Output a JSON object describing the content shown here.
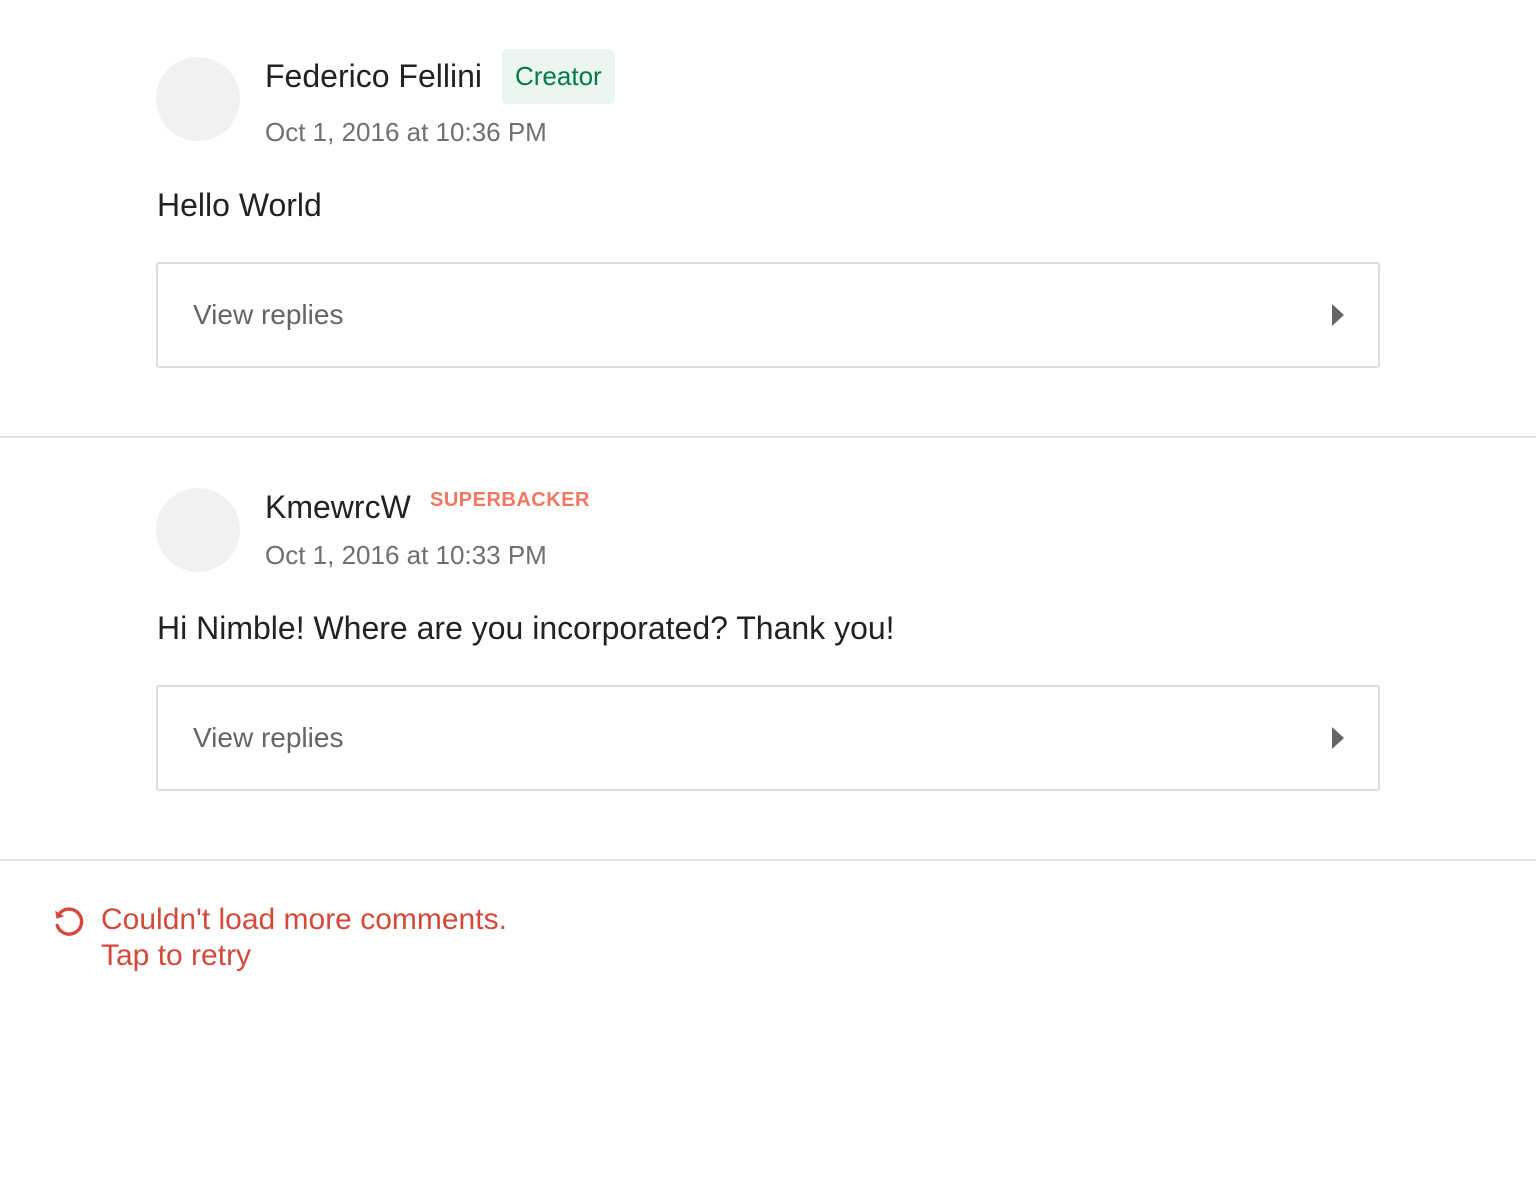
{
  "comments": [
    {
      "author": "Federico Fellini",
      "badge": "Creator",
      "timestamp": "Oct 1, 2016 at 10:36 PM",
      "body": "Hello World",
      "replies_label": "View replies"
    },
    {
      "author": "KmewrcW",
      "badge": "SUPERBACKER",
      "timestamp": "Oct 1, 2016 at 10:33 PM",
      "body": "Hi Nimble! Where are you incorporated? Thank you!",
      "replies_label": "View replies"
    }
  ],
  "error": {
    "line1": "Couldn't load more comments.",
    "line2": "Tap to retry",
    "icon": "retry-icon"
  },
  "colors": {
    "creator_badge_text": "#037a4b",
    "creator_badge_bg": "#eaf6ef",
    "superbacker": "#f07860",
    "error": "#d3493a"
  }
}
